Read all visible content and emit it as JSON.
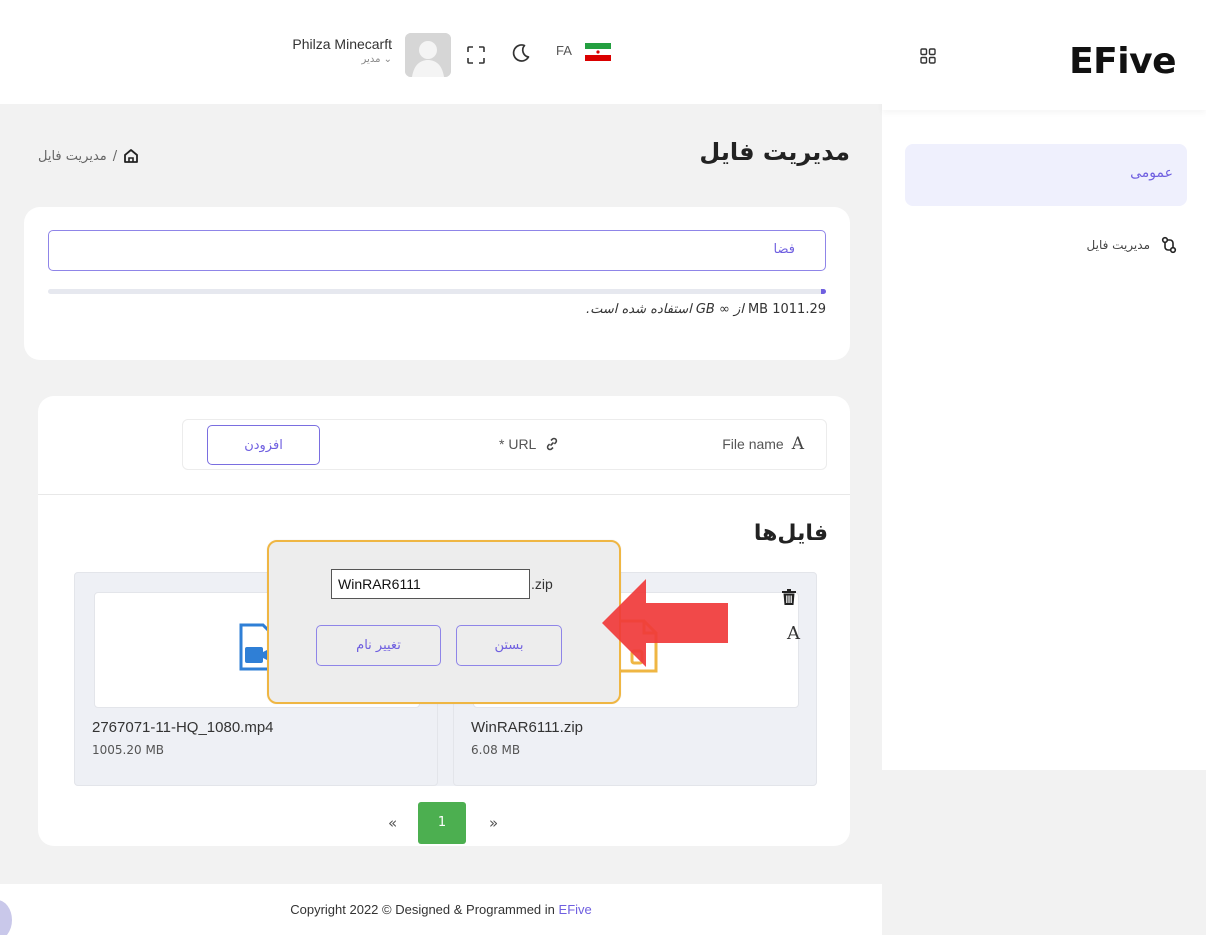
{
  "app": {
    "brand": "EFive"
  },
  "header": {
    "user_name": "Philza Minecarft",
    "user_role": "مدیر ⌄",
    "language": "FA"
  },
  "sidebar": {
    "section_label": "عمومی",
    "items": [
      {
        "label": "مدیریت فایل"
      }
    ]
  },
  "page": {
    "title": "مدیریت فایل",
    "breadcrumb": "مدیریت فایل",
    "breadcrumb_sep": "/"
  },
  "storage": {
    "label": "فضا",
    "used_fraction": 0.006,
    "usage_amount": "MB 1011.29",
    "usage_text": "از ∞ GB استفاده شده است."
  },
  "upload": {
    "file_name_label": "File name",
    "url_label": "* URL",
    "add_button": "افزودن"
  },
  "files": {
    "title": "فایل‌ها",
    "items": [
      {
        "name": "WinRAR6111.zip",
        "size": "6.08 MB",
        "icon": "zip-file-icon"
      },
      {
        "name": "2767071-11-HQ_1080.mp4",
        "size": "1005.20 MB",
        "icon": "video-file-icon"
      }
    ]
  },
  "pagination": {
    "prev": "«",
    "current": "1",
    "next": "»"
  },
  "rename_dialog": {
    "value": "WinRAR6111",
    "extension": ".zip",
    "rename_button": "تغییر نام",
    "close_button": "بستن"
  },
  "footer": {
    "copyright": "Copyright 2022 © Designed & Programmed in",
    "brand": "EFive"
  },
  "colors": {
    "accent": "#6f5fe0",
    "page_active": "#4caf50",
    "dialog_border": "#efb643",
    "arrow": "#f03a3a"
  }
}
